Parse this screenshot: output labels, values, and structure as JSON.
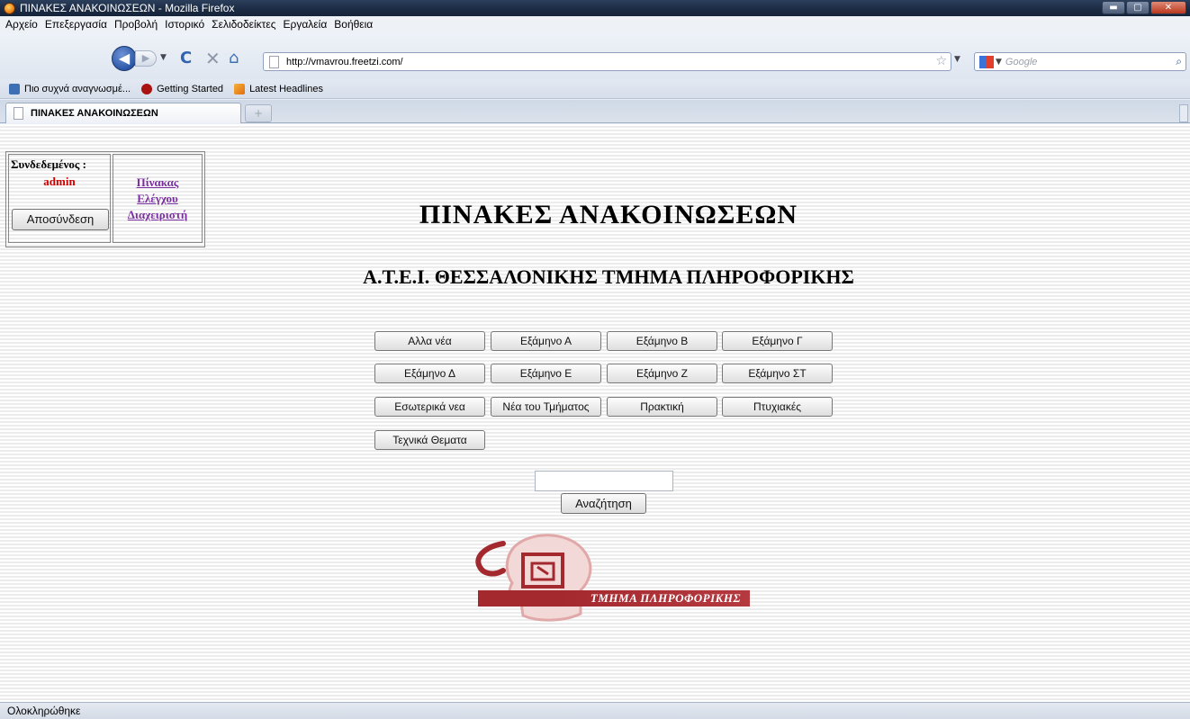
{
  "window": {
    "title": "ΠΙΝΑΚΕΣ ΑΝΑΚΟΙΝΩΣΕΩΝ - Mozilla Firefox",
    "controls": {
      "minimize": "▬",
      "maximize": "▢",
      "close": "✕"
    }
  },
  "menu": {
    "items": [
      "Αρχείο",
      "Επεξεργασία",
      "Προβολή",
      "Ιστορικό",
      "Σελιδοδείκτες",
      "Εργαλεία",
      "Βοήθεια"
    ]
  },
  "navbar": {
    "url": "http://vmavrou.freetzi.com/",
    "search_placeholder": "Google",
    "icons": {
      "back": "◀",
      "forward": "▶",
      "reload": "C",
      "stop": "✕",
      "home": "⌂",
      "star": "☆",
      "search": "⌕"
    }
  },
  "bookmarks": {
    "items": [
      "Πιο συχνά αναγνωσμέ...",
      "Getting Started",
      "Latest Headlines"
    ]
  },
  "tabs": {
    "active_label": "ΠΙΝΑΚΕΣ ΑΝΑΚΟΙΝΩΣΕΩΝ",
    "new_tab_symbol": "+"
  },
  "login": {
    "connected_label": "Συνδεδεμένος :",
    "username": "admin",
    "logout_label": "Αποσύνδεση",
    "admin_panel_lines": [
      "Πίνακας",
      "Ελέγχου",
      "Διαχειριστή"
    ]
  },
  "page": {
    "title": "ΠΙΝΑΚΕΣ ΑΝΑΚΟΙΝΩΣΕΩΝ",
    "subtitle": "Α.Τ.Ε.Ι. ΘΕΣΣΑΛΟΝΙΚΗΣ ΤΜΗΜΑ ΠΛΗΡΟΦΟΡΙΚΗΣ"
  },
  "categories": [
    "Αλλα νέα",
    "Εξάμηνο Α",
    "Εξάμηνο Β",
    "Εξάμηνο Γ",
    "Εξάμηνο Δ",
    "Εξάμηνο Ε",
    "Εξάμηνο Ζ",
    "Εξάμηνο ΣΤ",
    "Εσωτερικά νεα",
    "Νέα του Τμήματος",
    "Πρακτική",
    "Πτυχιακές",
    "Τεχνικά Θεματα"
  ],
  "search": {
    "value": "",
    "button_label": "Αναζήτηση"
  },
  "logo": {
    "text": "ΤΜΗΜΑ ΠΛΗΡΟΦΟΡΙΚΗΣ",
    "accent_color": "#a4292f"
  },
  "status": {
    "text": "Ολοκληρώθηκε"
  }
}
